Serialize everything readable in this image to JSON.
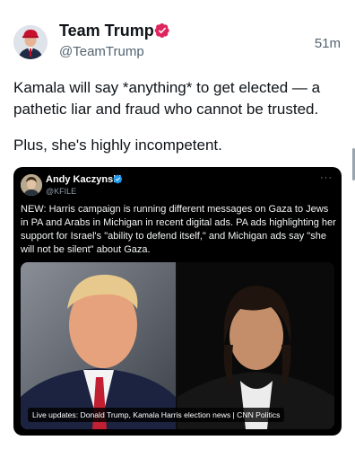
{
  "tweet": {
    "author_name": "Team Trump",
    "handle": "@TeamTrump",
    "timestamp": "51m",
    "text_line1": "Kamala will say *anything* to get elected — a pathetic liar and fraud who cannot be trusted.",
    "text_line2": "Plus, she's highly incompetent."
  },
  "quote": {
    "author_name": "Andy Kaczynski",
    "handle": "@KFILE",
    "more_label": "···",
    "text": "NEW: Harris campaign is running different messages on Gaza to Jews in PA and Arabs in Michigan in recent digital ads. PA ads highlighting her support for Israel's \"ability to defend itself,\" and Michigan ads say \"she will not be silent\" about Gaza.",
    "media_caption": "Live updates: Donald Trump, Kamala Harris election news | CNN Politics"
  },
  "colors": {
    "verified_red": "#e0245e",
    "verified_blue": "#1d9bf0",
    "text_primary": "#0f1419",
    "text_secondary": "#536471"
  },
  "icons": {
    "verified_main": "verified-badge-icon",
    "verified_quote": "verified-check-icon"
  }
}
